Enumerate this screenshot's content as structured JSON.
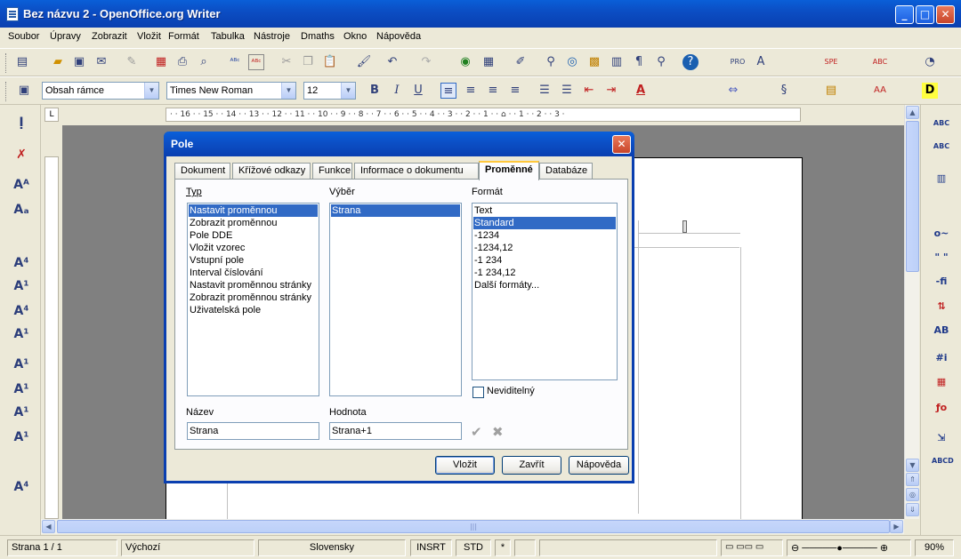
{
  "window": {
    "title": "Bez názvu 2 - OpenOffice.org Writer",
    "minimize": "_",
    "maximize": "□",
    "close": "✕"
  },
  "menu": [
    "Soubor",
    "Úpravy",
    "Zobrazit",
    "Vložit",
    "Formát",
    "Tabulka",
    "Nástroje",
    "Dmaths",
    "Okno",
    "Nápověda"
  ],
  "format_toolbar": {
    "style": "Obsah rámce",
    "font": "Times New Roman",
    "size": "12",
    "bold": "B",
    "italic": "I",
    "underline": "U"
  },
  "ruler": {
    "text": "· · 16 · · 15 · · 14 · · 13 · · 12 · · 11 · · 10 · · 9 · · 8 · · 7 · · 6 · · 5 · · 4 · · 3 · · 2 · · 1 · · ⌂ · · 1 · · 2 · · 3 ·",
    "corner": "L"
  },
  "dialog": {
    "title": "Pole",
    "close": "✕",
    "tabs": [
      "Dokument",
      "Křížové odkazy",
      "Funkce",
      "Informace o dokumentu",
      "Proměnné",
      "Databáze"
    ],
    "active_tab": "Proměnné",
    "type_label": "Typ",
    "select_label": "Výběr",
    "format_label": "Formát",
    "types": [
      "Nastavit proměnnou",
      "Zobrazit proměnnou",
      "Pole DDE",
      "Vložit vzorec",
      "Vstupní pole",
      "Interval číslování",
      "Nastavit proměnnou stránky",
      "Zobrazit proměnnou stránky",
      "Uživatelská pole"
    ],
    "selected_type": "Nastavit proměnnou",
    "selections": [
      "Strana"
    ],
    "formats": [
      "Text",
      "Standard",
      "-1234",
      "-1234,12",
      "-1 234",
      "-1 234,12",
      "Další formáty..."
    ],
    "selected_format": "Standard",
    "invisible_label": "Neviditelný",
    "name_label": "Název",
    "name_value": "Strana",
    "value_label": "Hodnota",
    "value_value": "Strana+1",
    "insert_button": "Vložit",
    "close_button": "Zavřít",
    "help_button": "Nápověda"
  },
  "status": {
    "page": "Strana 1 / 1",
    "style": "Výchozí",
    "language": "Slovensky",
    "insert_mode": "INSRT",
    "selection_mode": "STD",
    "modified": "*",
    "zoom": "90%"
  },
  "colors": {
    "titlebar": "#0a4fc6",
    "selection": "#316ac5",
    "workspace": "#808080",
    "dialog_bg": "#ece9d8"
  }
}
